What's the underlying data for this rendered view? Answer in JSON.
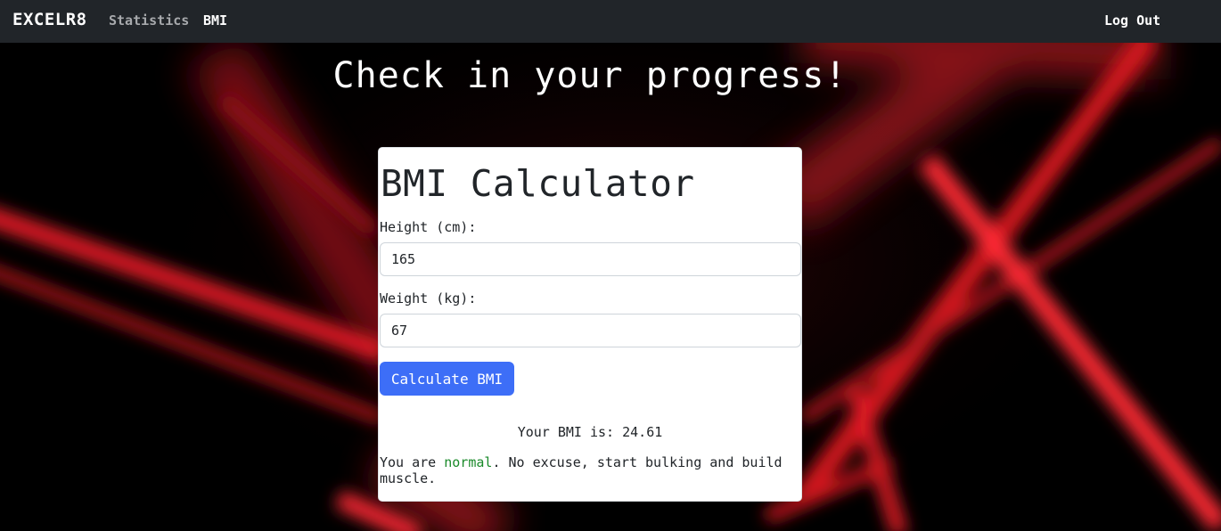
{
  "navbar": {
    "brand": "EXCELR8",
    "links": [
      "Statistics",
      "BMI"
    ],
    "logout_label": "Log Out"
  },
  "page": {
    "headline": "Check in your progress!"
  },
  "calculator": {
    "title": "BMI Calculator",
    "height_label": "Height (cm):",
    "height_value": "165",
    "weight_label": "Weight (kg):",
    "weight_value": "67",
    "button_label": "Calculate BMI",
    "result_text": "Your BMI is: 24.61",
    "message_prefix": "You are ",
    "category": "normal",
    "message_suffix": ". No excuse, start bulking and build muscle."
  },
  "colors": {
    "navbar_bg": "#212529",
    "button_bg": "#3d6ef7",
    "category_color": "#1a8a2a",
    "laser_red": "#ff1f2e"
  }
}
